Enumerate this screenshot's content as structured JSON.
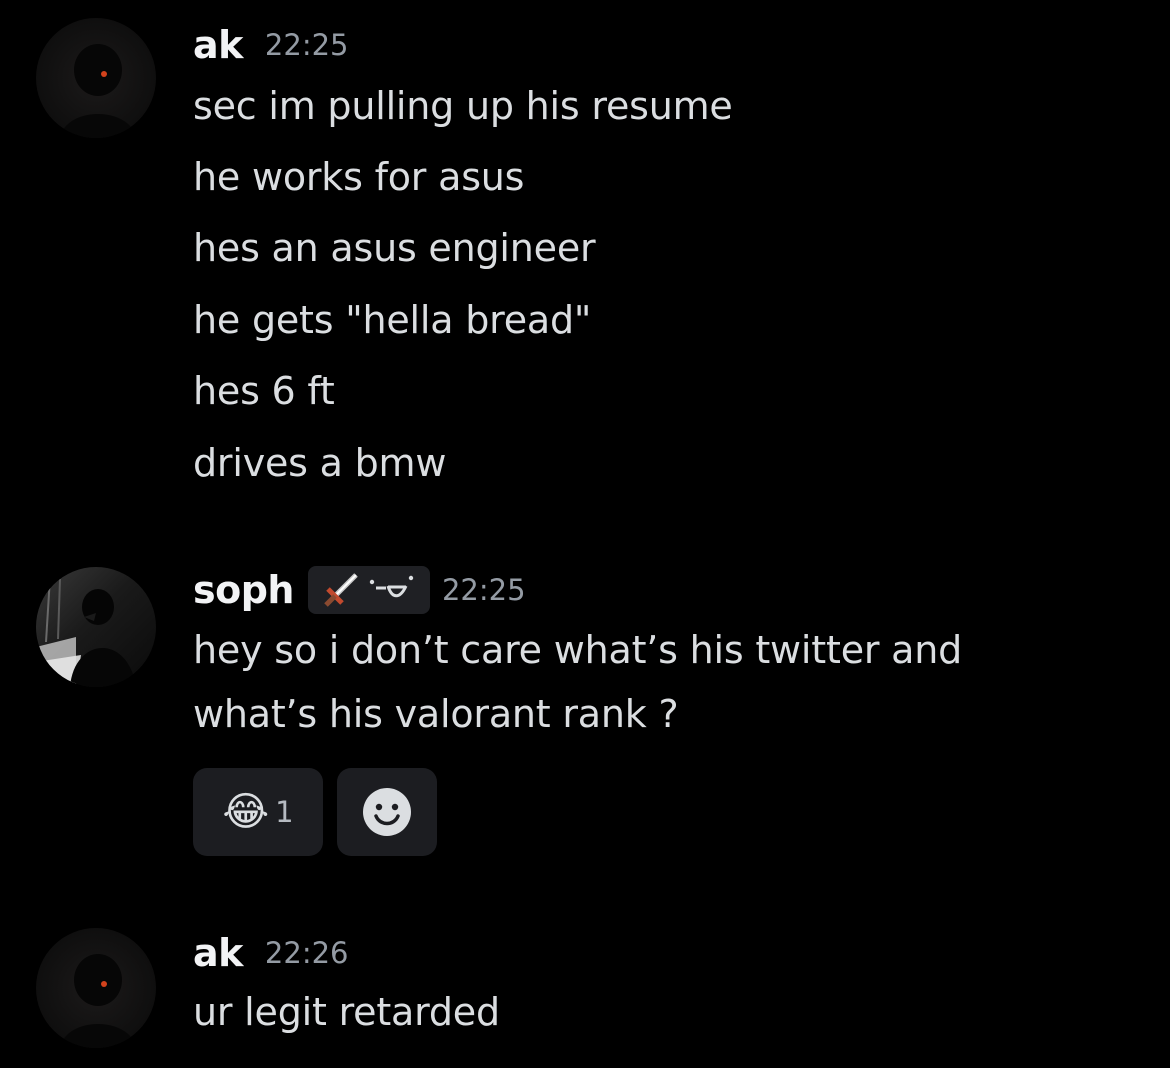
{
  "messages": [
    {
      "username": "ak",
      "timestamp": "22:25",
      "lines": [
        "sec im pulling up his resume",
        "he works for asus",
        "hes an asus engineer",
        "he gets \"hella bread\"",
        "hes 6 ft",
        "drives a bmw"
      ]
    },
    {
      "username": "soph",
      "timestamp": "22:25",
      "tag_icons": [
        "sword-icon",
        "smirk-face-icon"
      ],
      "lines": [
        "hey so i don’t care what’s his twitter and",
        "what’s his valorant rank ?"
      ],
      "reactions": [
        {
          "emoji": "😂",
          "icon": "tears-of-joy-emoji",
          "count": "1"
        }
      ],
      "add_reaction_icon": "add-reaction-smiley-icon"
    },
    {
      "username": "ak",
      "timestamp": "22:26",
      "lines": [
        "ur legit retarded"
      ]
    }
  ],
  "colors": {
    "background": "#000000",
    "username": "#f2f3f5",
    "message_text": "#dbdee1",
    "timestamp": "#949ba4",
    "reaction_bg": "#1c1d21"
  }
}
